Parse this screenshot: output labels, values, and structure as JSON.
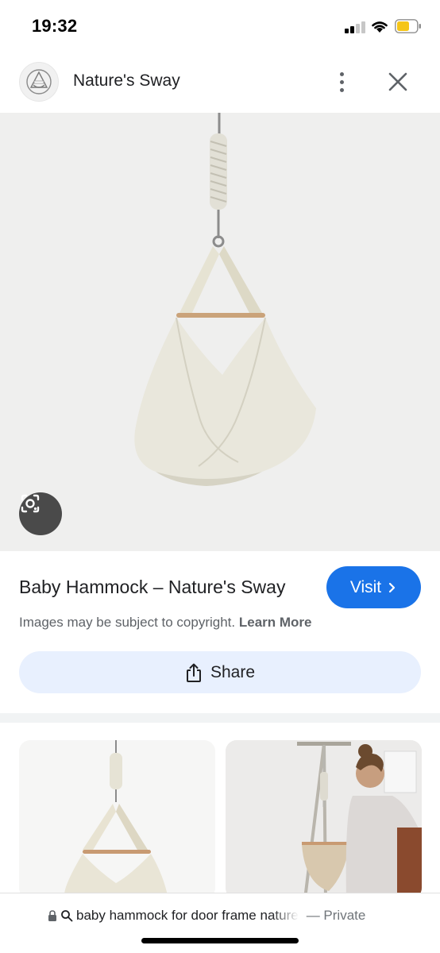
{
  "status_bar": {
    "time": "19:32",
    "signal_icon": "cellular-signal-icon",
    "wifi_icon": "wifi-icon",
    "battery_icon": "battery-icon",
    "battery_color": "#f5c518"
  },
  "header": {
    "site_name": "Nature's Sway",
    "logo_icon": "natures-sway-logo",
    "more_icon": "more-vertical-icon",
    "close_icon": "close-icon"
  },
  "hero": {
    "image_subject": "baby-hammock-photo",
    "lens_icon": "google-lens-icon"
  },
  "result": {
    "title": "Baby Hammock – Nature's Sway",
    "visit_label": "Visit",
    "visit_icon": "chevron-right-icon",
    "copyright_text": "Images may be subject to copyright.",
    "learn_more": "Learn More",
    "share_label": "Share",
    "share_icon": "share-icon"
  },
  "related": {
    "items": [
      {
        "image_subject": "baby-hammock-thumbnail"
      },
      {
        "image_subject": "woman-with-hammock-stand-thumbnail"
      }
    ]
  },
  "url_bar": {
    "lock_icon": "lock-icon",
    "search_icon": "search-icon",
    "query": "baby hammock for door frame nature",
    "private_label": "— Private"
  },
  "colors": {
    "accent": "#1a73e8",
    "share_bg": "#e8f0fe",
    "hero_bg": "#efefee"
  }
}
